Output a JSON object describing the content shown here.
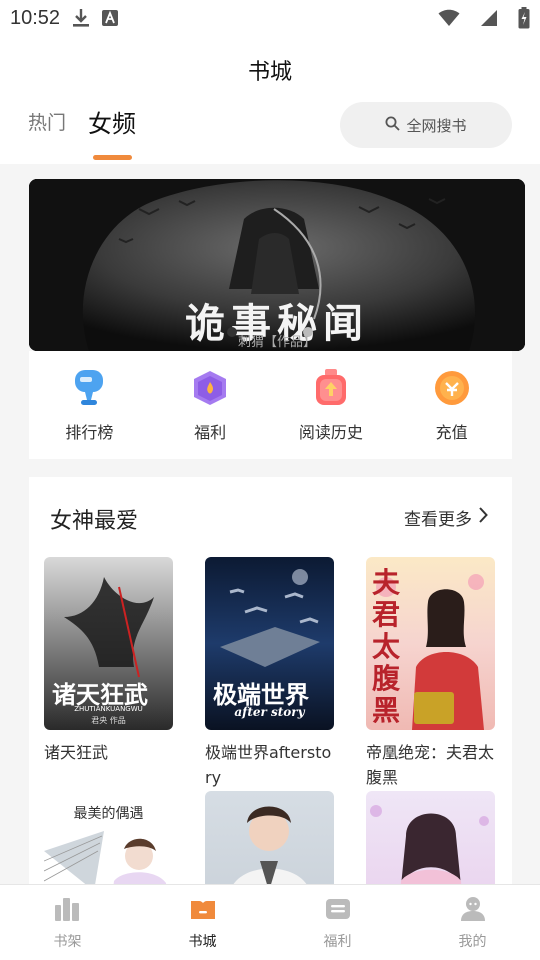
{
  "status_bar": {
    "time": "10:52"
  },
  "header": {
    "title": "书城",
    "tabs": [
      {
        "label": "热门",
        "active": false
      },
      {
        "label": "女频",
        "active": true
      }
    ],
    "search_label": "全网搜书",
    "accent_color": "#f08a3c"
  },
  "banner": {
    "title": "诡事秘闻",
    "author": "刺猬【作品】",
    "slide_count": 2,
    "active_slide": 2
  },
  "quick_links": [
    {
      "label": "排行榜",
      "icon": "trophy-icon"
    },
    {
      "label": "福利",
      "icon": "gift-icon"
    },
    {
      "label": "阅读历史",
      "icon": "history-icon"
    },
    {
      "label": "充值",
      "icon": "coin-icon"
    }
  ],
  "section": {
    "title": "女神最爱",
    "more_label": "查看更多",
    "books": [
      {
        "name": "诸天狂武",
        "cover_title": "诸天狂武",
        "cover_sub": "ZHUTIANKUANGWU",
        "cover_author": "君央 作品"
      },
      {
        "name": "极端世界afterstory",
        "cover_title": "极端世界",
        "cover_sub": "after story"
      },
      {
        "name": "帝凰绝宠：夫君太腹黑",
        "cover_title": "夫君太腹黑"
      },
      {
        "name": "",
        "cover_title": "最美的偶遇"
      },
      {
        "name": ""
      },
      {
        "name": ""
      }
    ]
  },
  "bottom_nav": [
    {
      "label": "书架",
      "icon": "bookshelf-icon",
      "active": false
    },
    {
      "label": "书城",
      "icon": "bookstore-icon",
      "active": true
    },
    {
      "label": "福利",
      "icon": "welfare-icon",
      "active": false
    },
    {
      "label": "我的",
      "icon": "profile-icon",
      "active": false
    }
  ]
}
